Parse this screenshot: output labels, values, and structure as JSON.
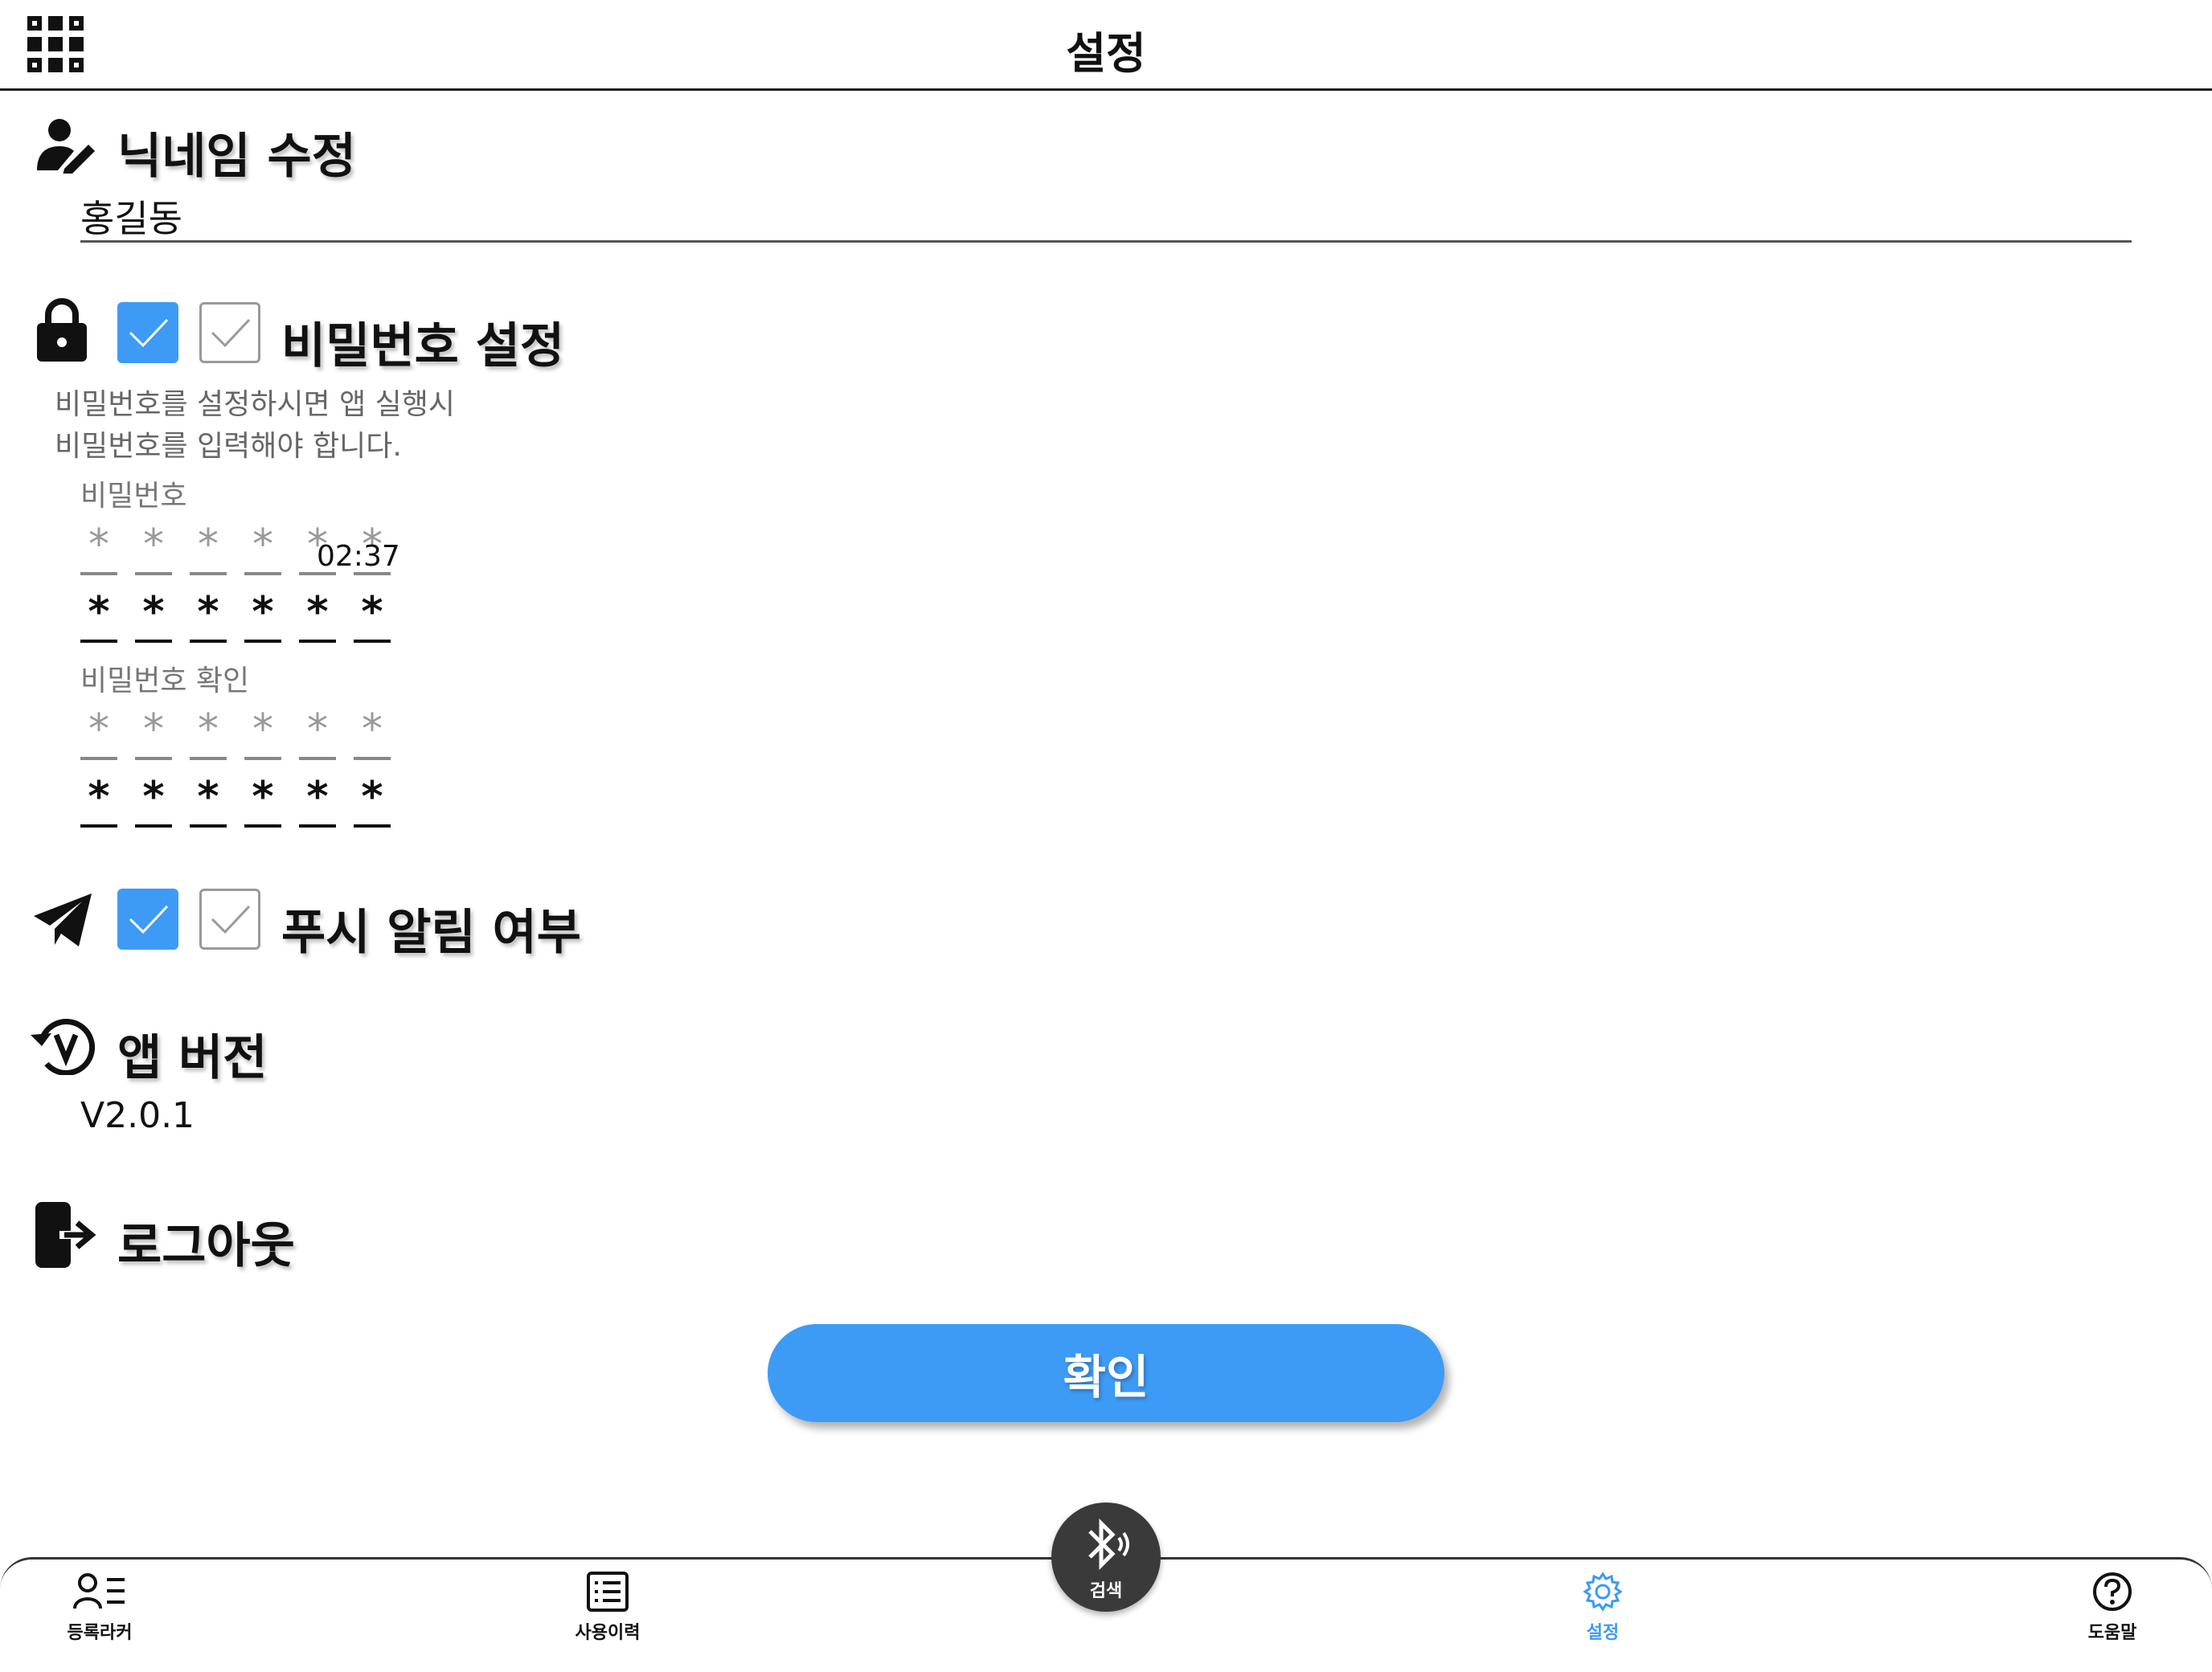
{
  "header": {
    "title": "설정"
  },
  "nickname": {
    "title": "닉네임 수정",
    "value": "홍길동"
  },
  "password": {
    "title": "비밀번호 설정",
    "desc_line1": "비밀번호를 설정하시면 앱 실행시",
    "desc_line2": "비밀번호를 입력해야 합니다.",
    "label": "비밀번호",
    "confirm_label": "비밀번호 확인",
    "timer": "02:37",
    "mask_char": "*"
  },
  "push": {
    "title": "푸시 알림 여부"
  },
  "version": {
    "title": "앱 버전",
    "value": "V2.0.1"
  },
  "logout": {
    "title": "로그아웃"
  },
  "confirm_button": "확인",
  "nav": {
    "items": [
      {
        "label": "등록라커"
      },
      {
        "label": "사용이력"
      },
      {
        "label": "설정"
      },
      {
        "label": "도움말"
      }
    ],
    "fab_label": "검색"
  },
  "colors": {
    "accent": "#3d9bf5",
    "fab": "#3a3a3a"
  }
}
